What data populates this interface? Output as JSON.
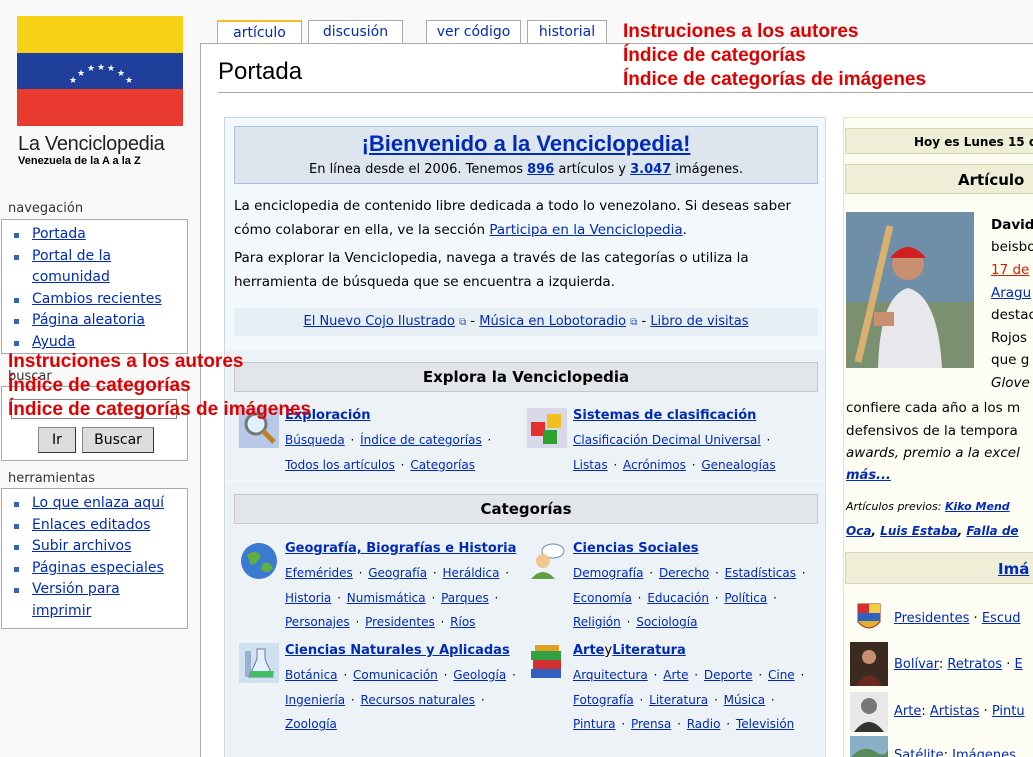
{
  "logo": {
    "title": "La Venciclopedia",
    "subtitle": "Venezuela de la A a la Z",
    "flag_colors": [
      "#f7d117",
      "#1f3f9a",
      "#e83a2e"
    ]
  },
  "sidebar": {
    "navigation_heading": "navegación",
    "navigation_items": [
      {
        "label": "Portada"
      },
      {
        "label": "Portal de la comunidad"
      },
      {
        "label": "Cambios recientes"
      },
      {
        "label": "Página aleatoria"
      },
      {
        "label": "Ayuda"
      }
    ],
    "search_heading": "buscar",
    "search_placeholder": "",
    "go_button": "Ir",
    "search_button": "Buscar",
    "tools_heading": "herramientas",
    "tools_items": [
      {
        "label": "Lo que enlaza aquí"
      },
      {
        "label": "Enlaces editados"
      },
      {
        "label": "Subir archivos"
      },
      {
        "label": "Páginas especiales"
      },
      {
        "label": "Versión para imprimir"
      }
    ]
  },
  "overlay_red": [
    "Instruciones a los autores",
    "Índice de categorías",
    "Índice de categorías de imágenes"
  ],
  "tabs": {
    "article": "artículo",
    "discussion": "discusión",
    "view_source": "ver código",
    "history": "historial"
  },
  "page_title": "Portada",
  "welcome": {
    "title": "¡Bienvenido a la Venciclopedia!",
    "line_pre": "En línea desde el 2006. Tenemos ",
    "articles_count": "896",
    "line_mid": " artículos y ",
    "images_count": "3.047",
    "line_post": " imágenes."
  },
  "intro": {
    "p1_a": "La enciclopedia de contenido libre dedicada a todo lo venezolano. Si deseas saber cómo colaborar en ella, ve la sección ",
    "p1_link": "Participa en la Venciclopedia",
    "p1_b": ".",
    "p2": "Para explorar la Venciclopedia, navega a través de las categorías o utiliza la herramienta de búsqueda que se encuentra a izquierda."
  },
  "links_bar": {
    "link1": "El Nuevo Cojo Ilustrado",
    "link2": "Música en Lobotoradio",
    "link3": "Libro de visitas",
    "sep": " - "
  },
  "explore": {
    "heading": "Explora la Venciclopedia",
    "left": {
      "title": "Exploración",
      "links": [
        "Búsqueda",
        "Índice de categorías",
        "Todos los artículos",
        "Categorías"
      ]
    },
    "right": {
      "title": "Sistemas de clasificación",
      "links": [
        "Clasificación Decimal Universal",
        "Listas",
        "Acrónimos",
        "Genealogías"
      ]
    }
  },
  "categories": {
    "heading": "Categorías",
    "geo": {
      "title": "Geografía, Biografías e Historia",
      "links": [
        "Efemérides",
        "Geografía",
        "Heráldica",
        "Historia",
        "Numismática",
        "Parques",
        "Personajes",
        "Presidentes",
        "Ríos"
      ]
    },
    "social": {
      "title": "Ciencias Sociales",
      "links": [
        "Demografía",
        "Derecho",
        "Estadísticas",
        "Economía",
        "Educación",
        "Política",
        "Religión",
        "Sociología"
      ]
    },
    "natural": {
      "title": "Ciencias Naturales y Aplicadas",
      "links": [
        "Botánica",
        "Comunicación",
        "Geología",
        "Ingeniería",
        "Recursos naturales",
        "Zoología"
      ]
    },
    "arts": {
      "title_a": "Arte",
      "title_y": " y ",
      "title_b": "Literatura",
      "links": [
        "Arquitectura",
        "Arte",
        "Deporte",
        "Cine",
        "Fotografía",
        "Literatura",
        "Música",
        "Pintura",
        "Prensa",
        "Radio",
        "Televisión"
      ]
    }
  },
  "right": {
    "today": "Hoy es Lunes 15 d",
    "featured_heading": "Artículo",
    "featured_lines": [
      {
        "text": "David",
        "bold": true
      },
      {
        "text": "beisbo"
      },
      {
        "text": "17 de",
        "link": true,
        "red": true
      },
      {
        "text": "Aragu",
        "link": true
      },
      {
        "text": "destac"
      },
      {
        "text": "Rojos"
      },
      {
        "text": "que g"
      },
      {
        "text": "Glove",
        "italic": true
      }
    ],
    "featured_more": [
      "confiere cada año a los m",
      "defensivos de la tempora",
      "awards, premio a la excel"
    ],
    "more_link": "más...",
    "prev_label": "Artículos previos: ",
    "prev_1": "Kiko Mend",
    "prev_2": "Oca",
    "prev_3": "Luis Estaba",
    "prev_4": "Falla de",
    "images_heading": "Imá",
    "image_rows": [
      {
        "a": "Presidentes",
        "b": "Escud"
      },
      {
        "a": "Bolívar",
        "b": "Retratos",
        "c": "E"
      },
      {
        "a": "Arte",
        "b": "Artistas",
        "c": "Pintu"
      },
      {
        "a": "Satélite",
        "b": "Imágenes"
      }
    ]
  }
}
